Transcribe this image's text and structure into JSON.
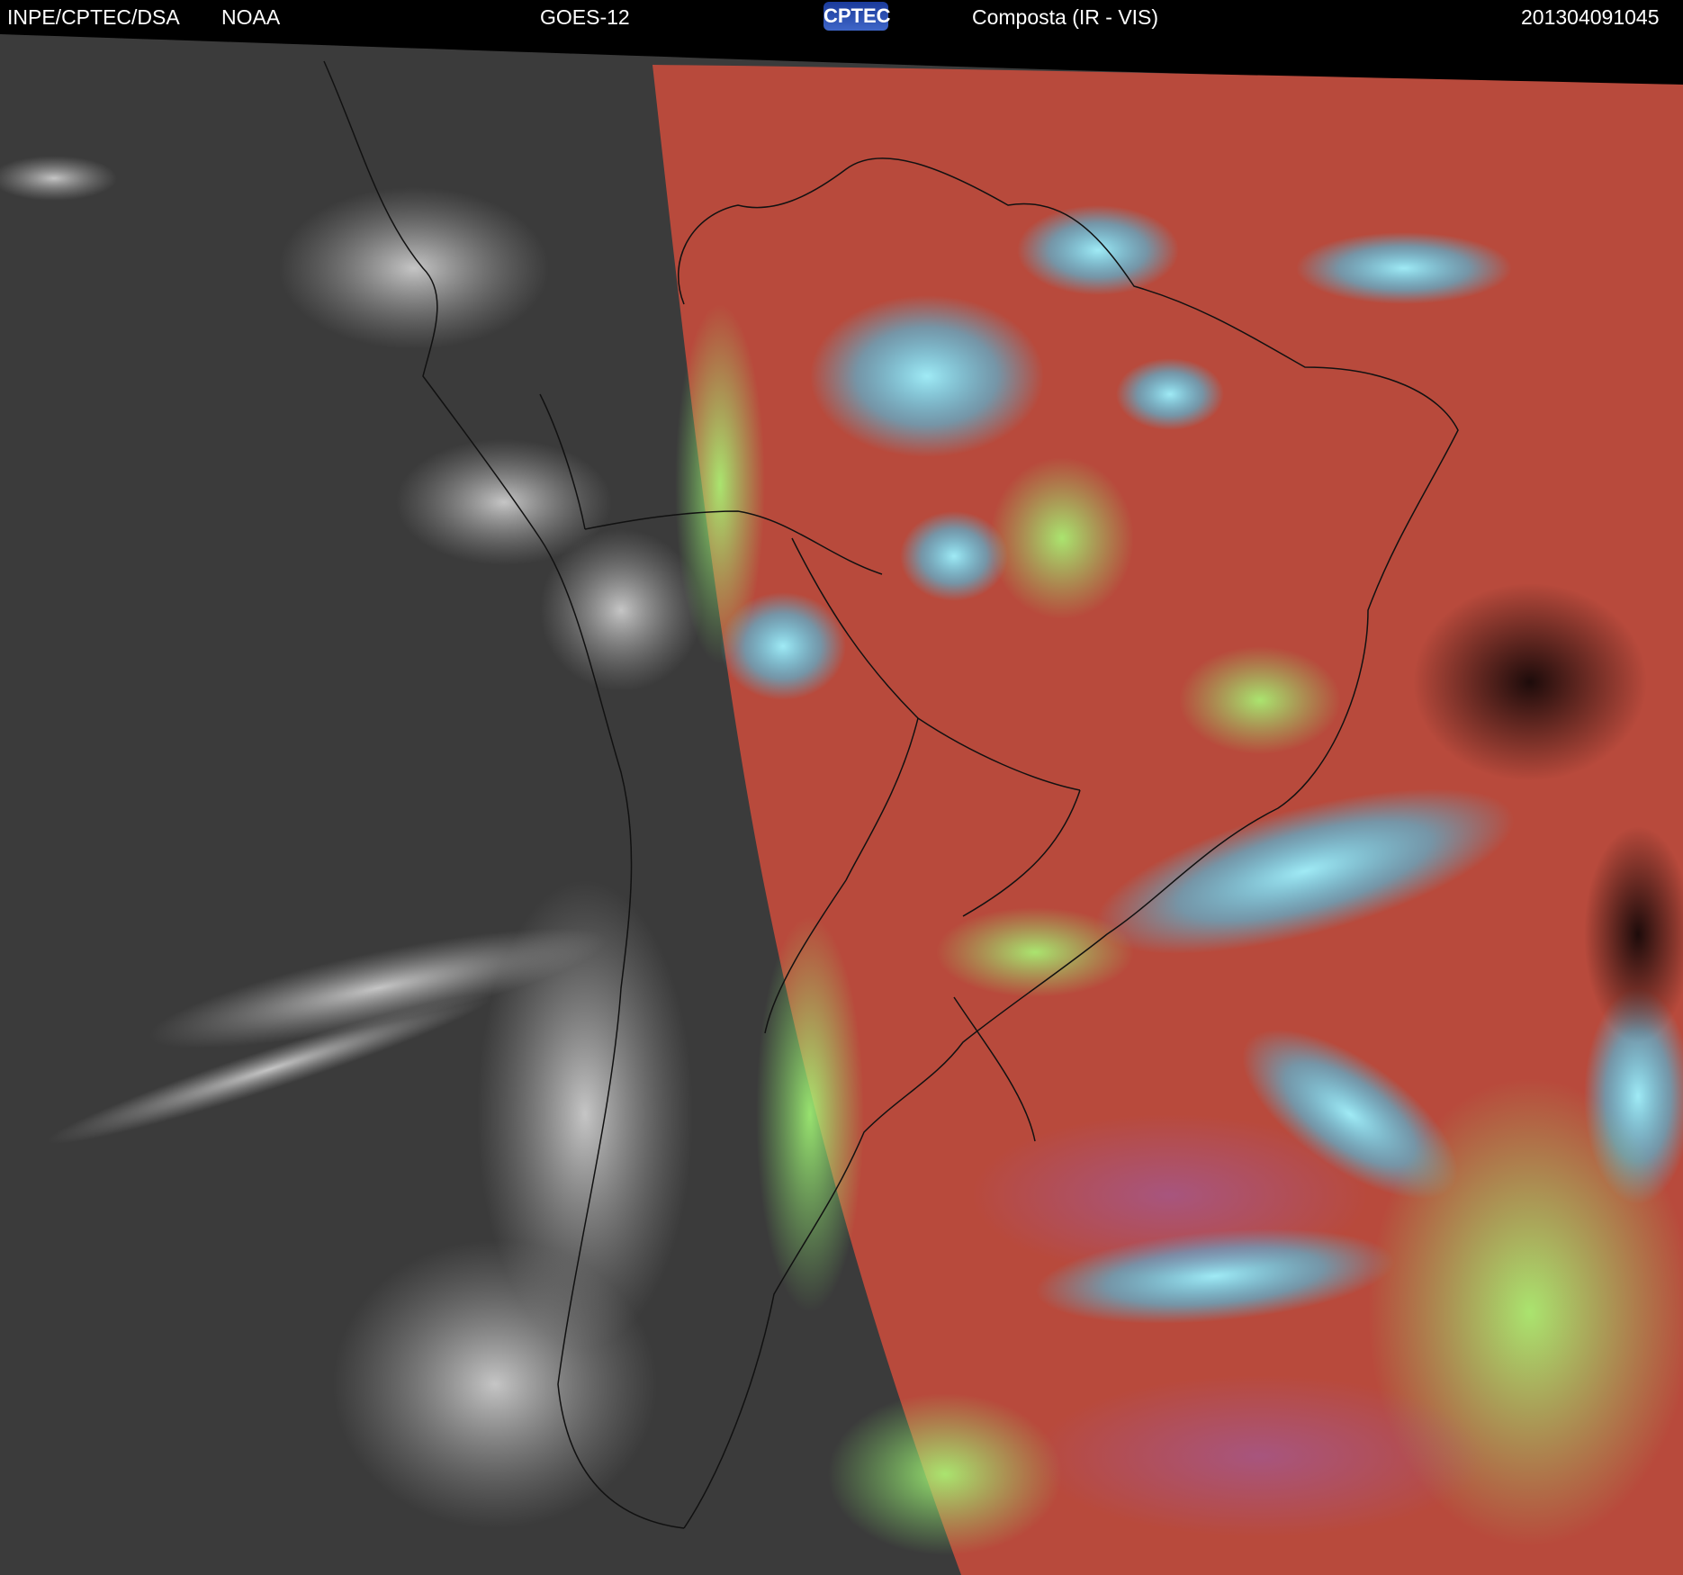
{
  "header": {
    "agency": "INPE/CPTEC/DSA",
    "source": "NOAA",
    "satellite": "GOES-12",
    "logo_text": "CPTEC",
    "product": "Composta (IR - VIS)",
    "timestamp": "201304091045"
  },
  "image": {
    "ir_region_color": "#3a3a3a",
    "composite_base_color": "#b84a3c",
    "cloud_cyan_color": "#3fd3ff",
    "cloud_green_color": "#8cf070",
    "border_line_color": "#111111"
  }
}
